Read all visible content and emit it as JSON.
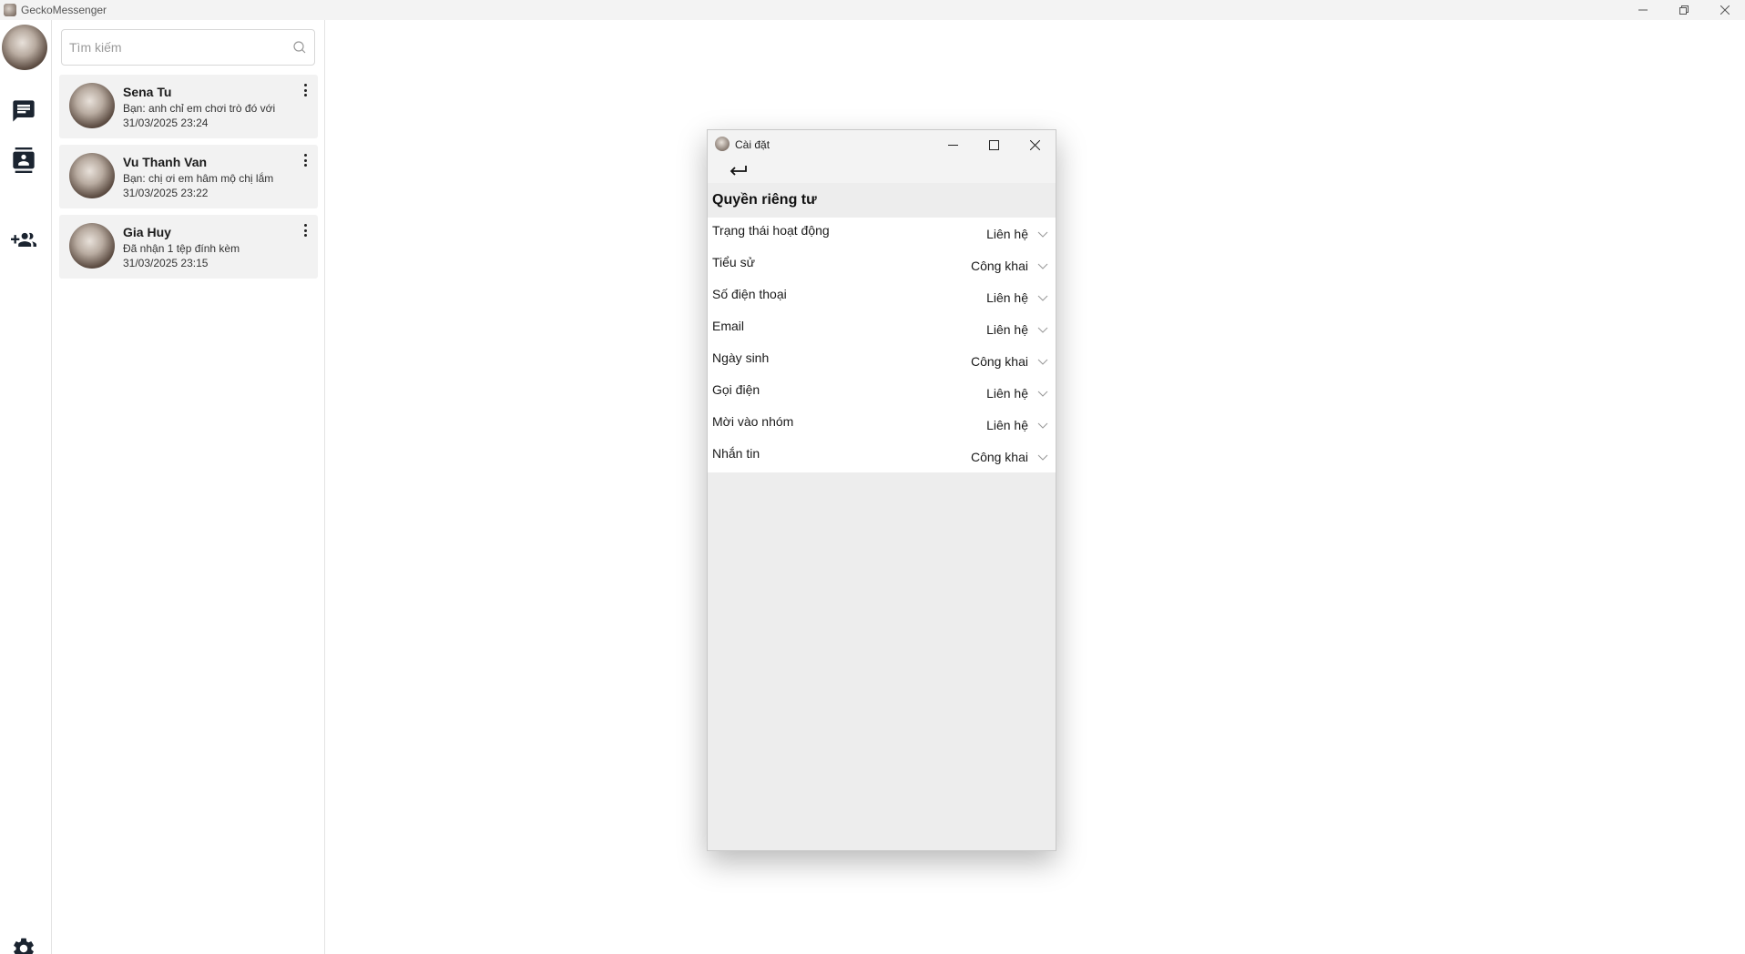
{
  "window": {
    "title": "GeckoMessenger",
    "icon": "app-logo-icon",
    "controls": [
      "minimize-icon",
      "restore-icon",
      "close-icon"
    ]
  },
  "rail": {
    "avatar": "user-avatar",
    "nav": [
      {
        "name": "chats",
        "icon": "chat-icon"
      },
      {
        "name": "contacts",
        "icon": "contacts-icon"
      },
      {
        "name": "add-friend",
        "icon": "add-group-icon"
      }
    ],
    "settings_icon": "gear-icon"
  },
  "search": {
    "placeholder": "Tìm kiếm",
    "icon": "search-icon"
  },
  "conversations": [
    {
      "name": "Sena Tu",
      "last_message": "Bạn: anh chỉ em chơi trò đó với",
      "time": "31/03/2025 23:24"
    },
    {
      "name": "Vu Thanh Van",
      "last_message": "Bạn: chị ơi em hâm mộ chị lắm",
      "time": "31/03/2025 23:22"
    },
    {
      "name": "Gia Huy",
      "last_message": "Đã nhận 1 tệp đính kèm",
      "time": "31/03/2025 23:15"
    }
  ],
  "settings_dialog": {
    "title": "Cài đặt",
    "back_icon": "back-arrow-icon",
    "section_title": "Quyền riêng tư",
    "rows": [
      {
        "label": "Trạng thái hoạt động",
        "value": "Liên hệ"
      },
      {
        "label": "Tiểu sử",
        "value": "Công khai"
      },
      {
        "label": "Số điện thoại",
        "value": "Liên hệ"
      },
      {
        "label": "Email",
        "value": "Liên hệ"
      },
      {
        "label": "Ngày sinh",
        "value": "Công khai"
      },
      {
        "label": "Gọi điện",
        "value": "Liên hệ"
      },
      {
        "label": "Mời vào nhóm",
        "value": "Liên hệ"
      },
      {
        "label": "Nhắn tin",
        "value": "Công khai"
      }
    ]
  },
  "colors": {
    "titlebar": "#f3f3f3",
    "conversation_bg": "#f2f2f2",
    "dialog_bg": "#ededed",
    "icon": "#1b2430"
  }
}
